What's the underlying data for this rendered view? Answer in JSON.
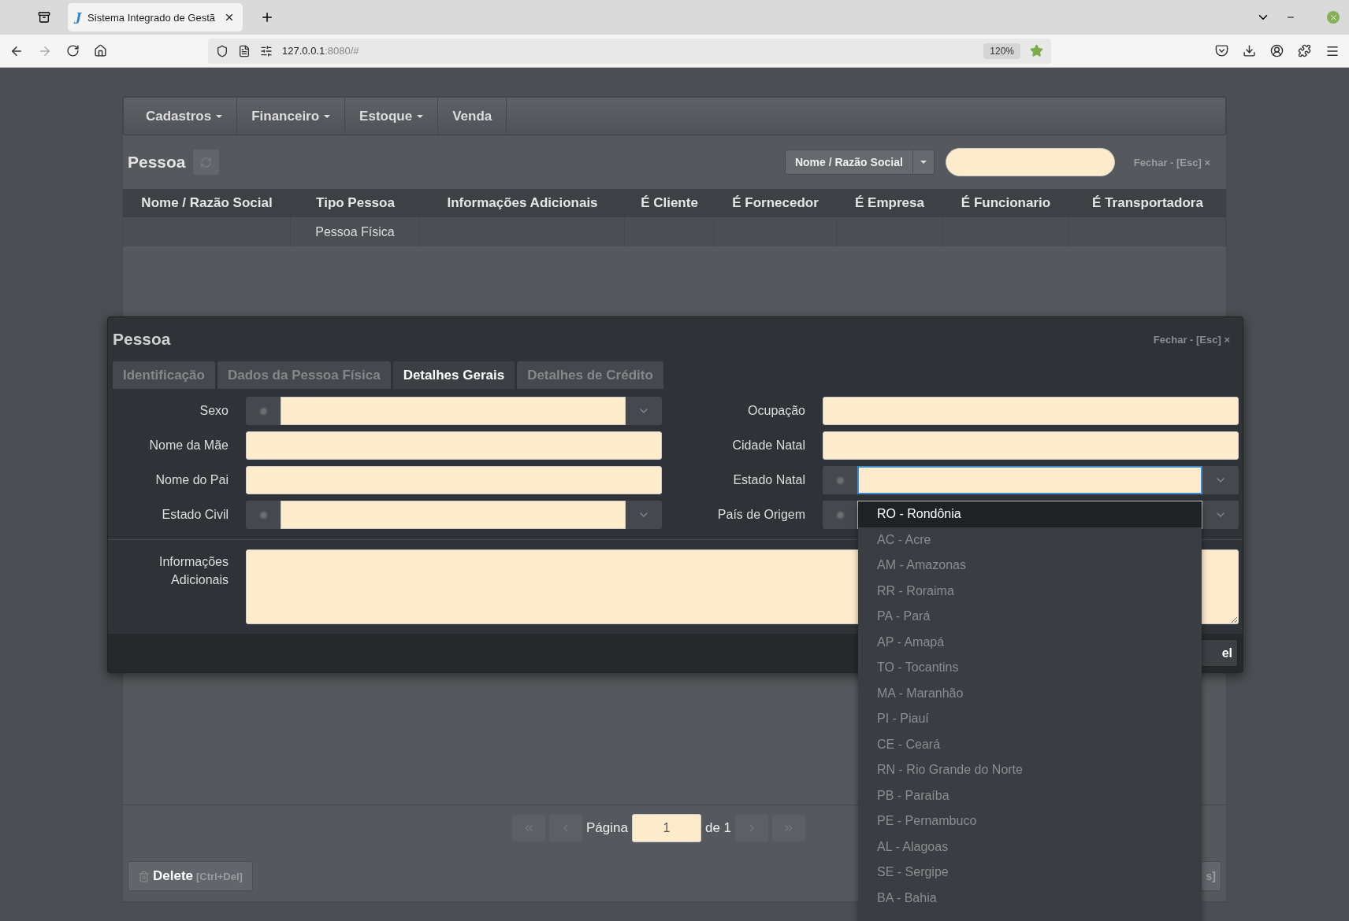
{
  "browser": {
    "tab_icon": "J",
    "tab_title": "Sistema Integrado de Gestã",
    "url_host": "127.0.0.1",
    "url_rest": ":8080/#",
    "zoom": "120%"
  },
  "navbar": [
    {
      "label": "Cadastros",
      "dropdown": true
    },
    {
      "label": "Financeiro",
      "dropdown": true
    },
    {
      "label": "Estoque",
      "dropdown": true
    },
    {
      "label": "Venda",
      "dropdown": false
    }
  ],
  "list": {
    "title": "Pessoa",
    "filter": "Nome / Razão Social",
    "close": "Fechar - [Esc] ×",
    "columns": [
      "Nome / Razão Social",
      "Tipo Pessoa",
      "Informações Adicionais",
      "É Cliente",
      "É Fornecedor",
      "É Empresa",
      "É Funcionario",
      "É Transportadora"
    ],
    "rows": [
      {
        "cells": [
          null,
          "Pessoa Física",
          null,
          null,
          null,
          null,
          null,
          null
        ]
      }
    ],
    "pagination": {
      "label": "Página",
      "page": "1",
      "of": "de 1"
    },
    "delete": {
      "label": "Delete",
      "shortcut": "[Ctrl+Del]"
    },
    "right_button_tail": "s]"
  },
  "modal": {
    "title": "Pessoa",
    "close": "Fechar - [Esc] ×",
    "tabs": [
      {
        "label": "Identificação",
        "selected": false
      },
      {
        "label": "Dados da Pessoa Física",
        "selected": false
      },
      {
        "label": "Detalhes Gerais",
        "selected": true
      },
      {
        "label": "Detalhes de Crédito",
        "selected": false
      }
    ],
    "fields": [
      {
        "label": "Sexo",
        "kind": "select",
        "focused": false
      },
      {
        "label": "Ocupação",
        "kind": "text",
        "focused": false
      },
      {
        "label": "Nome da Mãe",
        "kind": "text",
        "focused": false
      },
      {
        "label": "Cidade Natal",
        "kind": "text",
        "focused": false
      },
      {
        "label": "Nome do Pai",
        "kind": "text",
        "focused": false
      },
      {
        "label": "Estado Natal",
        "kind": "select",
        "focused": true
      },
      {
        "label": "Estado Civil",
        "kind": "select",
        "focused": false
      },
      {
        "label": "País de Origem",
        "kind": "select",
        "focused": false
      }
    ],
    "notes_label": "Informações Adicionais",
    "footer_button_tail": "el",
    "dropdown": [
      {
        "text": "RO - Rondônia",
        "selected": true
      },
      {
        "text": "AC - Acre",
        "selected": false
      },
      {
        "text": "AM - Amazonas",
        "selected": false
      },
      {
        "text": "RR - Roraima",
        "selected": false
      },
      {
        "text": "PA - Pará",
        "selected": false
      },
      {
        "text": "AP - Amapá",
        "selected": false
      },
      {
        "text": "TO - Tocantins",
        "selected": false
      },
      {
        "text": "MA - Maranhão",
        "selected": false
      },
      {
        "text": "PI - Piauí",
        "selected": false
      },
      {
        "text": "CE - Ceará",
        "selected": false
      },
      {
        "text": "RN - Rio Grande do Norte",
        "selected": false
      },
      {
        "text": "PB - Paraíba",
        "selected": false
      },
      {
        "text": "PE - Pernambuco",
        "selected": false
      },
      {
        "text": "AL - Alagoas",
        "selected": false
      },
      {
        "text": "SE - Sergipe",
        "selected": false
      },
      {
        "text": "BA - Bahia",
        "selected": false
      }
    ]
  }
}
